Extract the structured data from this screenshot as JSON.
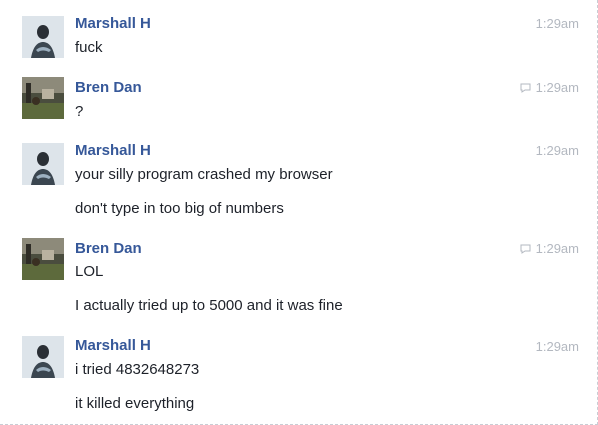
{
  "messages": [
    {
      "sender": "Marshall H",
      "time": "1:29am",
      "reply_icon": false,
      "lines": [
        "fuck"
      ]
    },
    {
      "sender": "Bren Dan",
      "time": "1:29am",
      "reply_icon": true,
      "lines": [
        "?"
      ]
    },
    {
      "sender": "Marshall H",
      "time": "1:29am",
      "reply_icon": false,
      "lines": [
        "your silly program crashed my browser",
        "don't type in too big of numbers"
      ]
    },
    {
      "sender": "Bren Dan",
      "time": "1:29am",
      "reply_icon": true,
      "lines": [
        "LOL",
        "I actually tried up to 5000 and it was fine"
      ]
    },
    {
      "sender": "Marshall H",
      "time": "1:29am",
      "reply_icon": false,
      "lines": [
        "i tried 4832648273",
        "it killed everything"
      ]
    }
  ],
  "colors": {
    "sender": "#365899",
    "timestamp": "#b3b8c0",
    "text": "#1d2129"
  },
  "icons": {
    "marshall_avatar": "user-avatar-icon",
    "bren_avatar": "user-avatar-photo",
    "reply": "speech-bubble-icon"
  }
}
